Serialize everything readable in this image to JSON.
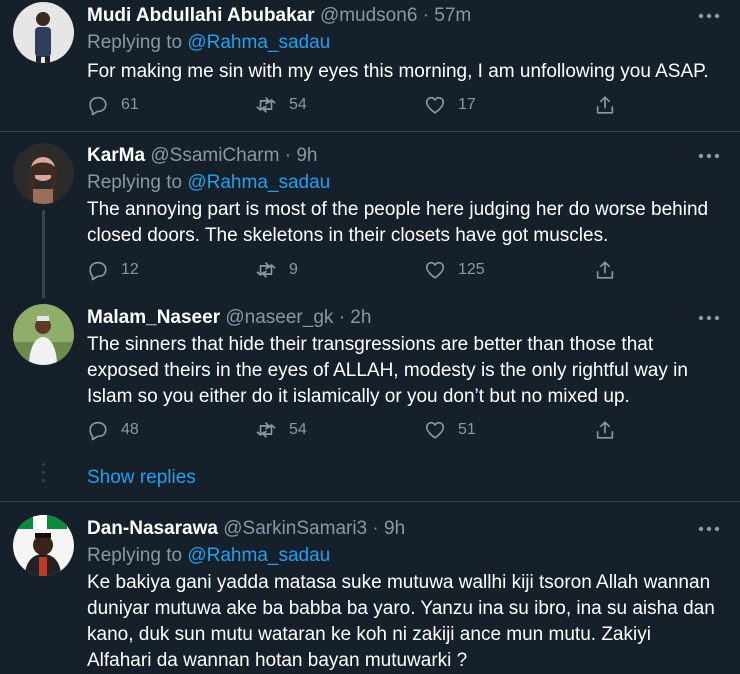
{
  "tweets": [
    {
      "name": "Mudi Abdullahi Abubakar",
      "handle": "@mudson6",
      "dot": "·",
      "time": "57m",
      "replying_prefix": "Replying to",
      "replying_to": "@Rahma_sadau",
      "text": "For making me sin with my eyes this morning, I am unfollowing you ASAP.",
      "replies": "61",
      "retweets": "54",
      "likes": "17"
    },
    {
      "name": "KarMa",
      "handle": "@SsamiCharm",
      "dot": "·",
      "time": "9h",
      "replying_prefix": "Replying to",
      "replying_to": "@Rahma_sadau",
      "text": "The annoying part is most of the people here judging her do worse behind closed doors. The skeletons in their closets have got muscles.",
      "replies": "12",
      "retweets": "9",
      "likes": "125"
    },
    {
      "name": "Malam_Naseer",
      "handle": "@naseer_gk",
      "dot": "·",
      "time": "2h",
      "text": "The sinners that hide their transgressions are better than those that exposed theirs in the eyes of ALLAH, modesty is the only rightful way in Islam so you either do it islamically or you don’t but no mixed up.",
      "replies": "48",
      "retweets": "54",
      "likes": "51"
    },
    {
      "name": "Dan-Nasarawa",
      "handle": "@SarkinSamari3",
      "dot": "·",
      "time": "9h",
      "replying_prefix": "Replying to",
      "replying_to": "@Rahma_sadau",
      "text": "Ke bakiya gani yadda matasa suke mutuwa wallhi kiji tsoron Allah wannan duniyar mutuwa ake ba babba ba yaro. Yanzu ina su ibro, ina su aisha dan kano,  duk sun mutu wataran ke koh ni zakiji ance mun mutu. Zakiyi Alfahari da wannan hotan bayan mutuwarki ?"
    }
  ],
  "show_replies": "Show replies",
  "icons": {
    "reply": "reply-icon",
    "retweet": "retweet-icon",
    "like": "like-icon",
    "share": "share-icon",
    "more": "more-icon"
  },
  "colors": {
    "background": "#15202b",
    "divider": "#38444d",
    "secondary_text": "#8899a6",
    "accent": "#1da1f2",
    "primary_text": "#ffffff"
  }
}
